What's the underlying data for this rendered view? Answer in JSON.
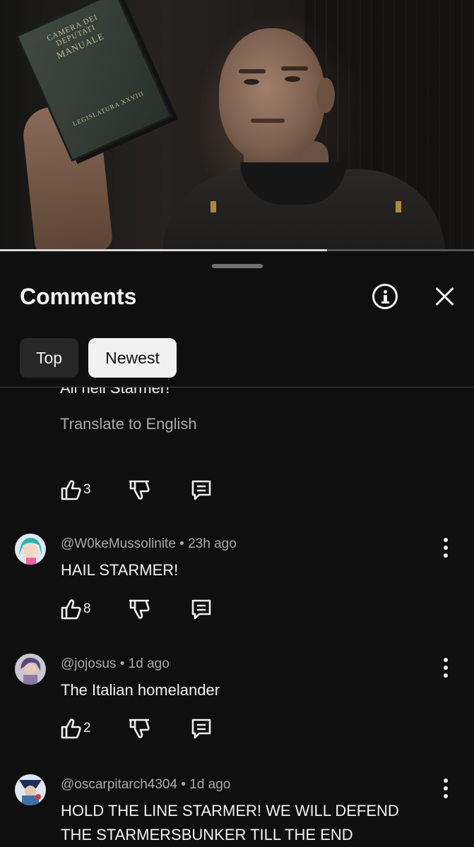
{
  "video": {
    "book_lines": [
      "CAMERA DEI DEPUTATI",
      "MANUALE",
      "LEGISLATURA XXVIII"
    ],
    "progress_fraction": 0.69
  },
  "comments_panel": {
    "title": "Comments",
    "filters": [
      {
        "label": "Top",
        "selected": false
      },
      {
        "label": "Newest",
        "selected": true
      }
    ],
    "partial_comment": {
      "text": "All hell Starmer!",
      "translate_label": "Translate to English",
      "likes": "3"
    },
    "comments": [
      {
        "author": "@W0keMussolinite",
        "age": "23h ago",
        "text": "HAIL STARMER!",
        "likes": "8",
        "avatar_color": "#2bb3b1"
      },
      {
        "author": "@jojosus",
        "age": "1d ago",
        "text": "The Italian homelander",
        "likes": "2",
        "avatar_color": "#5a4a7a"
      },
      {
        "author": "@oscarpitarch4304",
        "age": "1d ago",
        "text": "HOLD THE LINE STARMER! WE WILL DEFEND THE STARMERSBUNKER TILL THE END",
        "likes": "",
        "avatar_color": "#3e6fa8"
      }
    ]
  },
  "colors": {
    "background": "#0f0f0f",
    "text_primary": "#f1f1f1",
    "text_secondary": "#aaaaaa",
    "chip_inactive": "#272727",
    "chip_active": "#f1f1f1"
  },
  "icons": [
    "info-icon",
    "close-icon",
    "thumbs-up-icon",
    "thumbs-down-icon",
    "reply-icon",
    "more-vert-icon"
  ]
}
